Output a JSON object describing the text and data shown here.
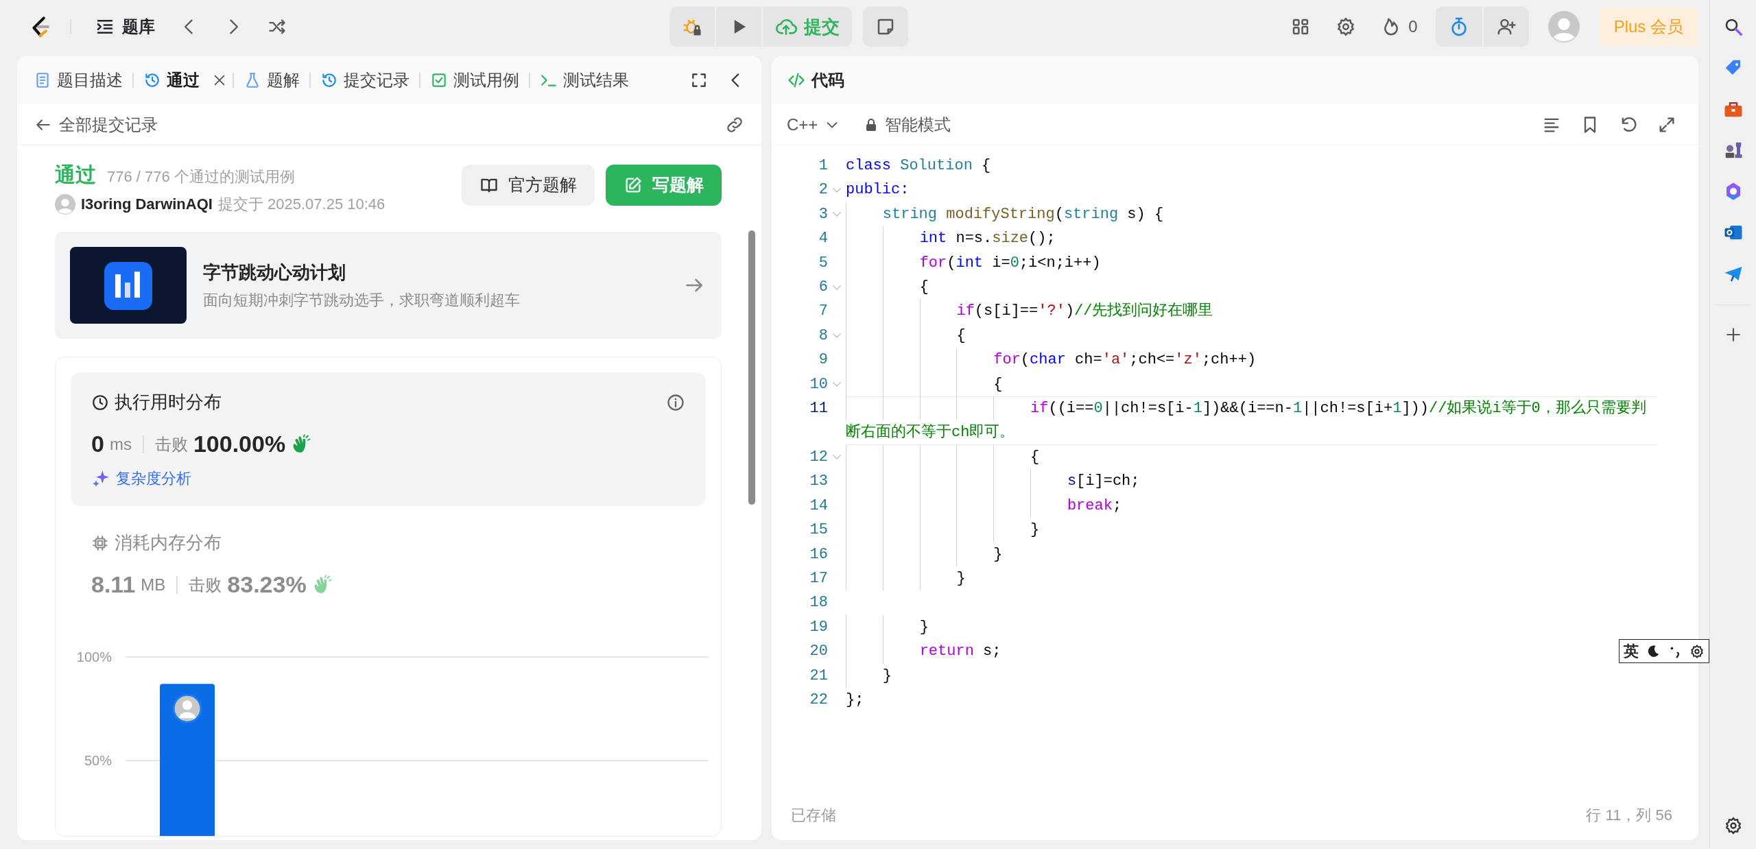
{
  "top_bar": {
    "problem_bank": "题库",
    "submit": "提交",
    "streak": "0",
    "plus": "Plus 会员"
  },
  "tabs": [
    {
      "label": "题目描述",
      "kind": "document",
      "selected": false,
      "closable": false
    },
    {
      "label": "通过",
      "kind": "history",
      "selected": true,
      "closable": true
    },
    {
      "label": "题解",
      "kind": "flask",
      "selected": false,
      "closable": false
    },
    {
      "label": "提交记录",
      "kind": "history",
      "selected": false,
      "closable": false
    },
    {
      "label": "测试用例",
      "kind": "checkbox",
      "selected": false,
      "closable": false
    },
    {
      "label": "测试结果",
      "kind": "terminal",
      "selected": false,
      "closable": false
    }
  ],
  "submission": {
    "back_label": "全部提交记录",
    "status": "通过",
    "summary": "776 / 776 个通过的测试用例",
    "user": "I3oring DarwinAQI",
    "submitted_at": "提交于 2025.07.25 10:46",
    "buttons": [
      {
        "label": "官方题解",
        "kind": "book"
      },
      {
        "label": "写题解",
        "kind": "edit"
      }
    ]
  },
  "promo": {
    "title": "字节跳动心动计划",
    "subtitle": "面向短期冲刺字节跳动选手，求职弯道顺利超车"
  },
  "distributions": [
    {
      "kind": "runtime",
      "selected": true,
      "title": "执行用时分布",
      "value": "0",
      "unit": "ms",
      "beats_label": "击败",
      "beats": "100.00%",
      "analysis": "复杂度分析"
    },
    {
      "kind": "memory",
      "selected": false,
      "title": "消耗内存分布",
      "value": "8.11",
      "unit": "MB",
      "beats_label": "击败",
      "beats": "83.23%",
      "chart_data": {
        "type": "bar",
        "values": [
          87
        ],
        "ylim": [
          0,
          100
        ],
        "yticks": [
          {
            "value": 100,
            "label": "100%"
          },
          {
            "value": 50,
            "label": "50%"
          }
        ]
      }
    }
  ],
  "editor": {
    "title": "代码",
    "language": "C++",
    "mode": "智能模式",
    "status_left": "已存储",
    "cursor": "行 11，列 56",
    "lines": [
      {
        "number": "1",
        "foldable": false,
        "tokens": [
          {
            "text": "class ",
            "kind": "kw"
          },
          {
            "text": "Solution",
            "kind": "type"
          },
          {
            "text": " {",
            "kind": "plain"
          }
        ]
      },
      {
        "number": "2",
        "foldable": true,
        "tokens": [
          {
            "text": "public:",
            "kind": "kw"
          }
        ]
      },
      {
        "number": "3",
        "foldable": true,
        "tokens": [
          {
            "text": "    string",
            "kind": "type"
          },
          {
            "text": " modifyString",
            "kind": "fn"
          },
          {
            "text": "(",
            "kind": "plain"
          },
          {
            "text": "string",
            "kind": "type"
          },
          {
            "text": " s) {",
            "kind": "plain"
          }
        ]
      },
      {
        "number": "4",
        "foldable": false,
        "tokens": [
          {
            "text": "        int",
            "kind": "kw"
          },
          {
            "text": " n=s.",
            "kind": "plain"
          },
          {
            "text": "size",
            "kind": "fn"
          },
          {
            "text": "();",
            "kind": "plain"
          }
        ]
      },
      {
        "number": "5",
        "foldable": false,
        "tokens": [
          {
            "text": "        for",
            "kind": "ctl"
          },
          {
            "text": "(",
            "kind": "plain"
          },
          {
            "text": "int",
            "kind": "kw"
          },
          {
            "text": " i=",
            "kind": "plain"
          },
          {
            "text": "0",
            "kind": "num"
          },
          {
            "text": ";i<n;i++)",
            "kind": "plain"
          }
        ]
      },
      {
        "number": "6",
        "foldable": true,
        "tokens": [
          {
            "text": "        {",
            "kind": "plain"
          }
        ]
      },
      {
        "number": "7",
        "foldable": false,
        "tokens": [
          {
            "text": "            if",
            "kind": "ctl"
          },
          {
            "text": "(s[i]==",
            "kind": "plain"
          },
          {
            "text": "'?'",
            "kind": "str"
          },
          {
            "text": ")",
            "kind": "plain"
          },
          {
            "text": "//先找到问好在哪里",
            "kind": "comment"
          }
        ]
      },
      {
        "number": "8",
        "foldable": true,
        "tokens": [
          {
            "text": "            {",
            "kind": "plain"
          }
        ]
      },
      {
        "number": "9",
        "foldable": false,
        "tokens": [
          {
            "text": "                for",
            "kind": "ctl"
          },
          {
            "text": "(",
            "kind": "plain"
          },
          {
            "text": "char",
            "kind": "kw"
          },
          {
            "text": " ch=",
            "kind": "plain"
          },
          {
            "text": "'a'",
            "kind": "str"
          },
          {
            "text": ";ch<=",
            "kind": "plain"
          },
          {
            "text": "'z'",
            "kind": "str"
          },
          {
            "text": ";ch++)",
            "kind": "plain"
          }
        ]
      },
      {
        "number": "10",
        "foldable": true,
        "tokens": [
          {
            "text": "                {",
            "kind": "plain"
          }
        ]
      },
      {
        "number": "11",
        "foldable": false,
        "current": true,
        "tokens": [
          {
            "text": "                    if",
            "kind": "ctl"
          },
          {
            "text": "((i==",
            "kind": "plain"
          },
          {
            "text": "0",
            "kind": "num"
          },
          {
            "text": "||ch!=s[i-",
            "kind": "plain"
          },
          {
            "text": "1",
            "kind": "num"
          },
          {
            "text": "])&&(i==n-",
            "kind": "plain"
          },
          {
            "text": "1",
            "kind": "num"
          },
          {
            "text": "||ch!=s[i+",
            "kind": "plain"
          },
          {
            "text": "1",
            "kind": "num"
          },
          {
            "text": "]))",
            "kind": "plain"
          },
          {
            "text": "//如果说i等于0，那么只需要判断右面的不等于ch即可。",
            "kind": "comment"
          }
        ]
      },
      {
        "number": "12",
        "foldable": true,
        "tokens": [
          {
            "text": "                    {",
            "kind": "plain"
          }
        ]
      },
      {
        "number": "13",
        "foldable": false,
        "tokens": [
          {
            "text": "                        s",
            "kind": "var"
          },
          {
            "text": "[i]=ch;",
            "kind": "plain"
          }
        ]
      },
      {
        "number": "14",
        "foldable": false,
        "tokens": [
          {
            "text": "                        break",
            "kind": "ctl"
          },
          {
            "text": ";",
            "kind": "plain"
          }
        ]
      },
      {
        "number": "15",
        "foldable": false,
        "tokens": [
          {
            "text": "                    }",
            "kind": "plain"
          }
        ]
      },
      {
        "number": "16",
        "foldable": false,
        "tokens": [
          {
            "text": "                }",
            "kind": "plain"
          }
        ]
      },
      {
        "number": "17",
        "foldable": false,
        "tokens": [
          {
            "text": "            }",
            "kind": "plain"
          }
        ]
      },
      {
        "number": "18",
        "foldable": false
      },
      {
        "number": "19",
        "foldable": false,
        "tokens": [
          {
            "text": "        }",
            "kind": "plain"
          }
        ]
      },
      {
        "number": "20",
        "foldable": false,
        "tokens": [
          {
            "text": "        return",
            "kind": "ctl"
          },
          {
            "text": " s;",
            "kind": "plain"
          }
        ]
      },
      {
        "number": "21",
        "foldable": false,
        "tokens": [
          {
            "text": "    }",
            "kind": "plain"
          }
        ]
      },
      {
        "number": "22",
        "foldable": false,
        "tokens": [
          {
            "text": "};",
            "kind": "plain"
          }
        ]
      }
    ]
  },
  "ime": {
    "label": "英"
  }
}
